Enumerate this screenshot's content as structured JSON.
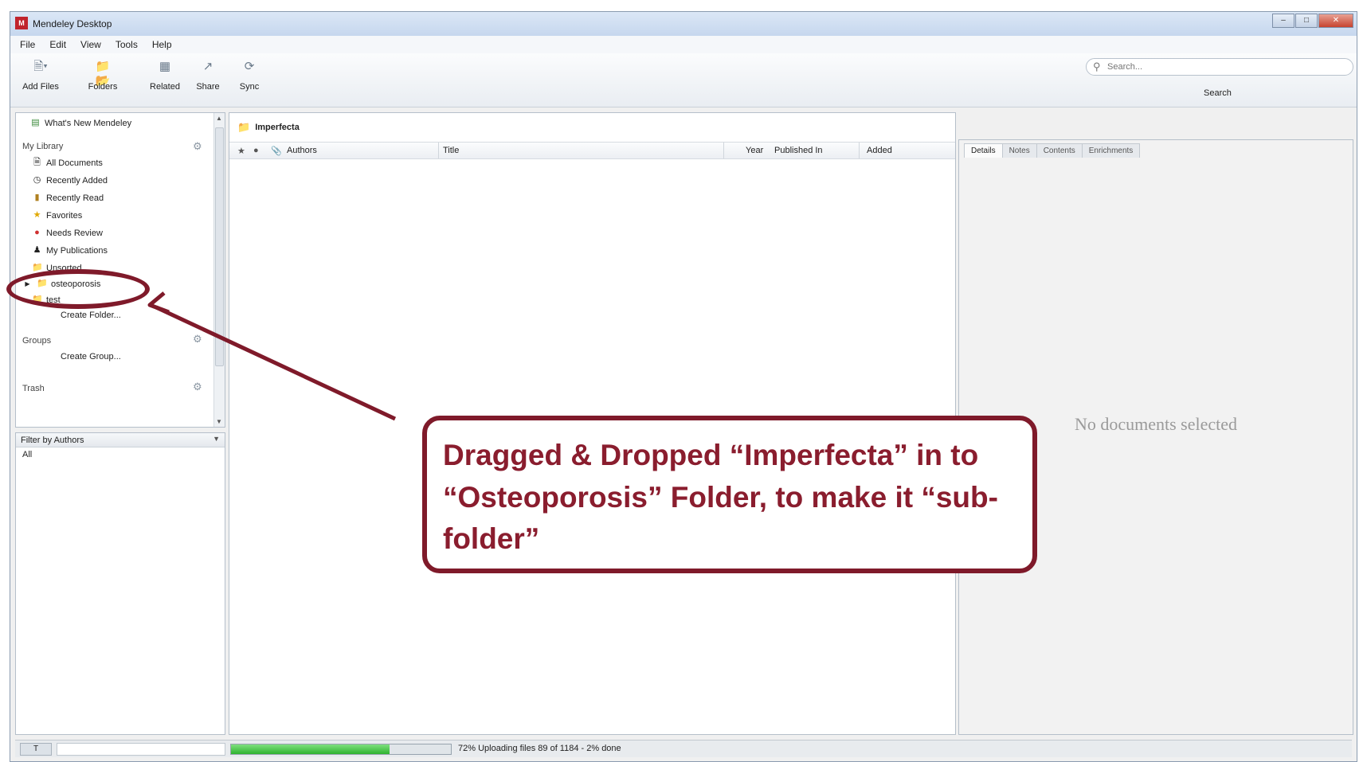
{
  "window": {
    "title": "Mendeley Desktop"
  },
  "menu": [
    "File",
    "Edit",
    "View",
    "Tools",
    "Help"
  ],
  "toolbar": {
    "add_files": "Add Files",
    "folders": "Folders",
    "related": "Related",
    "share": "Share",
    "sync": "Sync",
    "search_placeholder": "Search...",
    "search_label": "Search"
  },
  "sidebar": {
    "whats_new": "What's New Mendeley",
    "my_library": "My Library",
    "items": [
      {
        "label": "All Documents",
        "icon": "document-icon"
      },
      {
        "label": "Recently Added",
        "icon": "clock-icon"
      },
      {
        "label": "Recently Read",
        "icon": "book-icon"
      },
      {
        "label": "Favorites",
        "icon": "star-icon"
      },
      {
        "label": "Needs Review",
        "icon": "review-icon"
      },
      {
        "label": "My Publications",
        "icon": "person-icon"
      },
      {
        "label": "Unsorted",
        "icon": "folder-icon"
      },
      {
        "label": "osteoporosis",
        "icon": "folder-icon"
      },
      {
        "label": "test",
        "icon": "folder-icon"
      },
      {
        "label": "Create Folder...",
        "icon": ""
      }
    ],
    "groups": "Groups",
    "create_group": "Create Group...",
    "trash": "Trash"
  },
  "filter": {
    "heading": "Filter by Authors",
    "all": "All"
  },
  "main": {
    "breadcrumb": "Imperfecta",
    "columns": [
      "Authors",
      "Title",
      "Year",
      "Published In",
      "Added"
    ]
  },
  "details": {
    "tabs": [
      "Details",
      "Notes",
      "Contents",
      "Enrichments"
    ],
    "empty": "No documents selected"
  },
  "status": {
    "t_button": "T",
    "progress": 0.72,
    "text": "72%  Uploading files 89 of 1184 - 2% done"
  },
  "annotation": {
    "text": "Dragged & Dropped “Imperfecta” in to “Osteoporosis” Folder, to make it “sub-folder”",
    "color": "#7f1a2a"
  }
}
